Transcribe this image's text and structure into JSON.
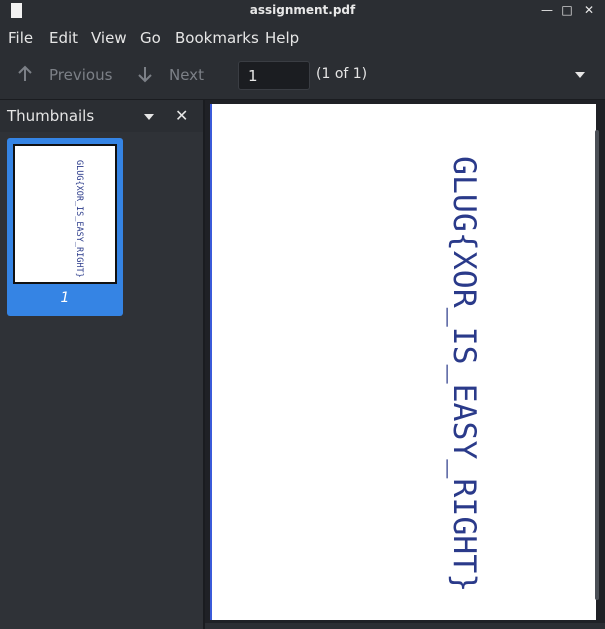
{
  "window": {
    "title": "assignment.pdf",
    "controls": {
      "minimize": "—",
      "maximize": "□",
      "close": "✕"
    }
  },
  "menu": [
    "File",
    "Edit",
    "View",
    "Go",
    "Bookmarks",
    "Help"
  ],
  "toolbar": {
    "previous_label": "Previous",
    "next_label": "Next",
    "page_value": "1",
    "page_count": "(1 of 1)"
  },
  "sidebar": {
    "title": "Thumbnails",
    "thumbnail_label": "1"
  },
  "document": {
    "handwritten_text": "GLUG{XOR_IS_EASY_RIGHT}"
  },
  "colors": {
    "accent": "#3584e4",
    "ink": "#2a3a8a"
  }
}
